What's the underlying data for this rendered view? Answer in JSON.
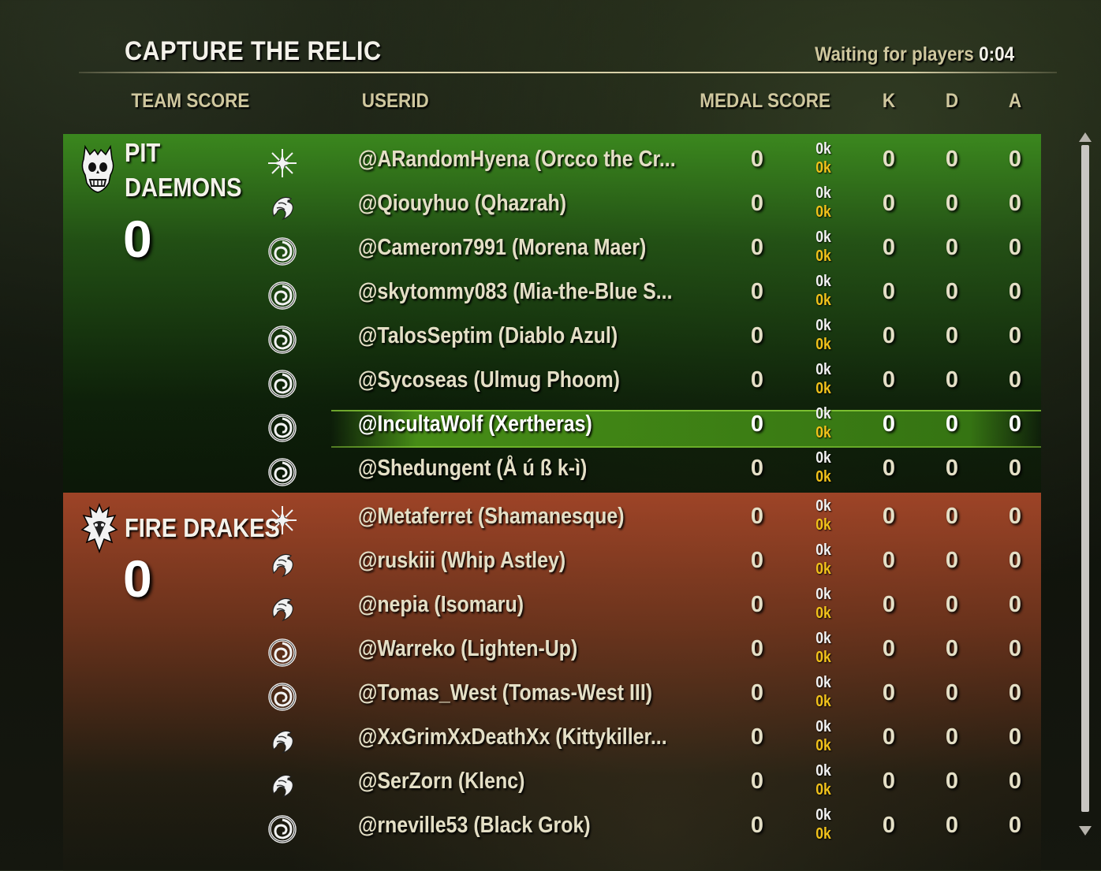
{
  "header": {
    "title": "CAPTURE THE RELIC",
    "waiting_label": "Waiting for players",
    "timer": "0:04"
  },
  "columns": {
    "team_score": "TEAM SCORE",
    "userid": "USERID",
    "medal_score": "MEDAL SCORE",
    "k": "K",
    "d": "D",
    "a": "A"
  },
  "teams": [
    {
      "name": "PIT\nDAEMONS",
      "score": "0",
      "emblem": "skull-emblem-icon",
      "color": "#3c8c1e",
      "players": [
        {
          "user": "@ARandomHyena (Orcco the Cr...",
          "class_icon": "star-burst-icon",
          "medal": "0",
          "ok1": "0k",
          "ok2": "0k",
          "k": "0",
          "d": "0",
          "a": "0"
        },
        {
          "user": "@Qiouyhuo (Qhazrah)",
          "class_icon": "dragon-swirl-icon",
          "medal": "0",
          "ok1": "0k",
          "ok2": "0k",
          "k": "0",
          "d": "0",
          "a": "0"
        },
        {
          "user": "@Cameron7991 (Morena Maer)",
          "class_icon": "vortex-icon",
          "medal": "0",
          "ok1": "0k",
          "ok2": "0k",
          "k": "0",
          "d": "0",
          "a": "0"
        },
        {
          "user": "@skytommy083 (Mia-the-Blue S...",
          "class_icon": "vortex-icon",
          "medal": "0",
          "ok1": "0k",
          "ok2": "0k",
          "k": "0",
          "d": "0",
          "a": "0"
        },
        {
          "user": "@TalosSeptim (Diablo Azul)",
          "class_icon": "vortex-icon",
          "medal": "0",
          "ok1": "0k",
          "ok2": "0k",
          "k": "0",
          "d": "0",
          "a": "0"
        },
        {
          "user": "@Sycoseas (Ulmug Phoom)",
          "class_icon": "vortex-icon",
          "medal": "0",
          "ok1": "0k",
          "ok2": "0k",
          "k": "0",
          "d": "0",
          "a": "0"
        },
        {
          "user": "@IncultaWolf (Xertheras)",
          "class_icon": "vortex-icon",
          "medal": "0",
          "ok1": "0k",
          "ok2": "0k",
          "k": "0",
          "d": "0",
          "a": "0",
          "self": true
        },
        {
          "user": "@Shedungent (Å ú ß k-ì)",
          "class_icon": "vortex-icon",
          "medal": "0",
          "ok1": "0k",
          "ok2": "0k",
          "k": "0",
          "d": "0",
          "a": "0"
        }
      ]
    },
    {
      "name": "FIRE DRAKES",
      "score": "0",
      "emblem": "drake-emblem-icon",
      "color": "#a5462a",
      "players": [
        {
          "user": "@Metaferret (Shamanesque)",
          "class_icon": "star-burst-icon",
          "medal": "0",
          "ok1": "0k",
          "ok2": "0k",
          "k": "0",
          "d": "0",
          "a": "0"
        },
        {
          "user": "@ruskiii (Whip Astley)",
          "class_icon": "dragon-swirl-icon",
          "medal": "0",
          "ok1": "0k",
          "ok2": "0k",
          "k": "0",
          "d": "0",
          "a": "0"
        },
        {
          "user": "@nepia (Isomaru)",
          "class_icon": "dragon-swirl-icon",
          "medal": "0",
          "ok1": "0k",
          "ok2": "0k",
          "k": "0",
          "d": "0",
          "a": "0"
        },
        {
          "user": "@Warreko (Lighten-Up)",
          "class_icon": "vortex-icon",
          "medal": "0",
          "ok1": "0k",
          "ok2": "0k",
          "k": "0",
          "d": "0",
          "a": "0"
        },
        {
          "user": "@Tomas_West (Tomas-West III)",
          "class_icon": "vortex-icon",
          "medal": "0",
          "ok1": "0k",
          "ok2": "0k",
          "k": "0",
          "d": "0",
          "a": "0"
        },
        {
          "user": "@XxGrimXxDeathXx (Kittykiller...",
          "class_icon": "dragon-swirl-icon",
          "medal": "0",
          "ok1": "0k",
          "ok2": "0k",
          "k": "0",
          "d": "0",
          "a": "0"
        },
        {
          "user": "@SerZorn (Klenc)",
          "class_icon": "dragon-swirl-icon",
          "medal": "0",
          "ok1": "0k",
          "ok2": "0k",
          "k": "0",
          "d": "0",
          "a": "0"
        },
        {
          "user": "@rneville53 (Black Grok)",
          "class_icon": "vortex-icon",
          "medal": "0",
          "ok1": "0k",
          "ok2": "0k",
          "k": "0",
          "d": "0",
          "a": "0"
        }
      ]
    }
  ]
}
